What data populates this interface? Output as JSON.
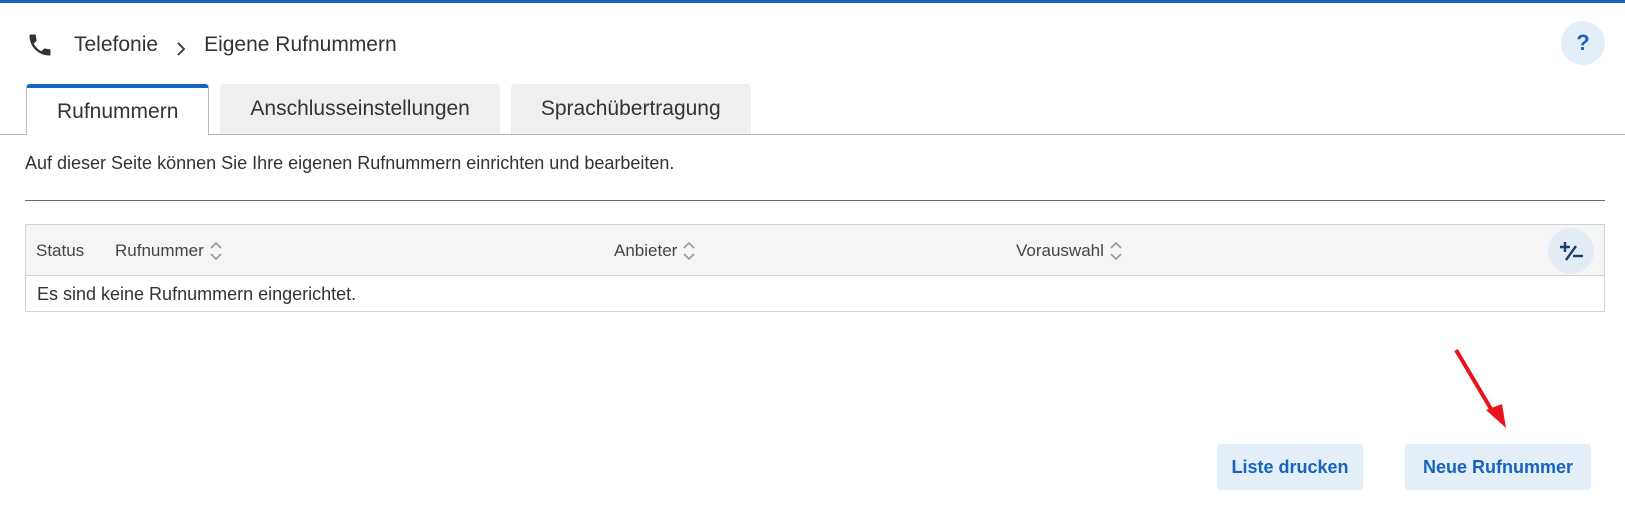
{
  "breadcrumb": {
    "section": "Telefonie",
    "page": "Eigene Rufnummern"
  },
  "help": {
    "label": "?"
  },
  "tabs": [
    {
      "label": "Rufnummern",
      "active": true
    },
    {
      "label": "Anschlusseinstellungen",
      "active": false
    },
    {
      "label": "Sprachübertragung",
      "active": false
    }
  ],
  "description": "Auf dieser Seite können Sie Ihre eigenen Rufnummern einrichten und bearbeiten.",
  "table": {
    "columns": [
      "Status",
      "Rufnummer",
      "Anbieter",
      "Vorauswahl"
    ],
    "empty_message": "Es sind keine Rufnummern eingerichtet."
  },
  "buttons": {
    "print": "Liste drucken",
    "new": "Neue Rufnummer"
  },
  "colors": {
    "accent": "#1565c0",
    "button_bg": "#e4eef8",
    "annotation_arrow": "#e8141b"
  }
}
